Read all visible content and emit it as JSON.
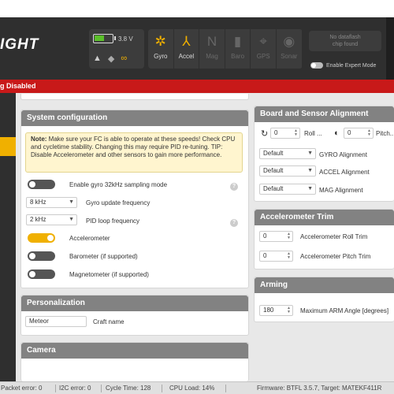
{
  "header": {
    "logo_text": "IGHT",
    "battery_voltage": "3.8 V",
    "battery_level": 0.55,
    "sensors": [
      {
        "label": "Gyro",
        "icon": "gyro-icon",
        "glyph": "✲",
        "active": true
      },
      {
        "label": "Accel",
        "icon": "accel-icon",
        "glyph": "⅄",
        "active": true
      },
      {
        "label": "Mag",
        "icon": "mag-icon",
        "glyph": "N",
        "active": false
      },
      {
        "label": "Baro",
        "icon": "baro-icon",
        "glyph": "▮",
        "active": false
      },
      {
        "label": "GPS",
        "icon": "gps-icon",
        "glyph": "⌖",
        "active": false
      },
      {
        "label": "Sonar",
        "icon": "sonar-icon",
        "glyph": "◉",
        "active": false
      }
    ],
    "dataflash_line1": "No dataflash",
    "dataflash_line2": "chip found",
    "expert_mode_label": "Enable Expert Mode",
    "accent_color": "#f0b000"
  },
  "arming_bar": {
    "text": "g Disabled",
    "color": "#c81919"
  },
  "system_config": {
    "title": "System configuration",
    "note_label": "Note:",
    "note_text": " Make sure your FC is able to operate at these speeds! Check CPU and cycletime stability. Changing this may require PID re-tuning. TIP: Disable Accelerometer and other sensors to gain more performance.",
    "gyro32_label": "Enable gyro 32kHz sampling mode",
    "gyro32_enabled": false,
    "gyro_freq_value": "8 kHz",
    "gyro_freq_label": "Gyro update frequency",
    "pid_freq_value": "2 kHz",
    "pid_freq_label": "PID loop frequency",
    "accelerometer_label": "Accelerometer",
    "accelerometer_enabled": true,
    "barometer_label": "Barometer (if supported)",
    "barometer_enabled": false,
    "magnetometer_label": "Magnetometer (if supported)",
    "magnetometer_enabled": false
  },
  "personalization": {
    "title": "Personalization",
    "craft_name_value": "Meteor",
    "craft_name_label": "Craft name"
  },
  "camera": {
    "title": "Camera"
  },
  "board_alignment": {
    "title": "Board and Sensor Alignment",
    "roll_value": "0",
    "roll_label": "Roll ...",
    "pitch_value": "0",
    "pitch_label": "Pitch...",
    "gyro_align_value": "Default",
    "gyro_align_label": "GYRO Alignment",
    "accel_align_value": "Default",
    "accel_align_label": "ACCEL Alignment",
    "mag_align_value": "Default",
    "mag_align_label": "MAG Alignment"
  },
  "accel_trim": {
    "title": "Accelerometer Trim",
    "roll_value": "0",
    "roll_label": "Accelerometer Roll Trim",
    "pitch_value": "0",
    "pitch_label": "Accelerometer Pitch Trim"
  },
  "arming": {
    "title": "Arming",
    "angle_value": "180",
    "angle_label": "Maximum ARM Angle [degrees]"
  },
  "footer": {
    "packet_error": "Packet error: 0",
    "i2c_error": "I2C error: 0",
    "cycle_time": "Cycle Time: 128",
    "cpu_load": "CPU Load: 14%",
    "firmware": "Firmware: BTFL 3.5.7, Target: MATEKF411R"
  }
}
